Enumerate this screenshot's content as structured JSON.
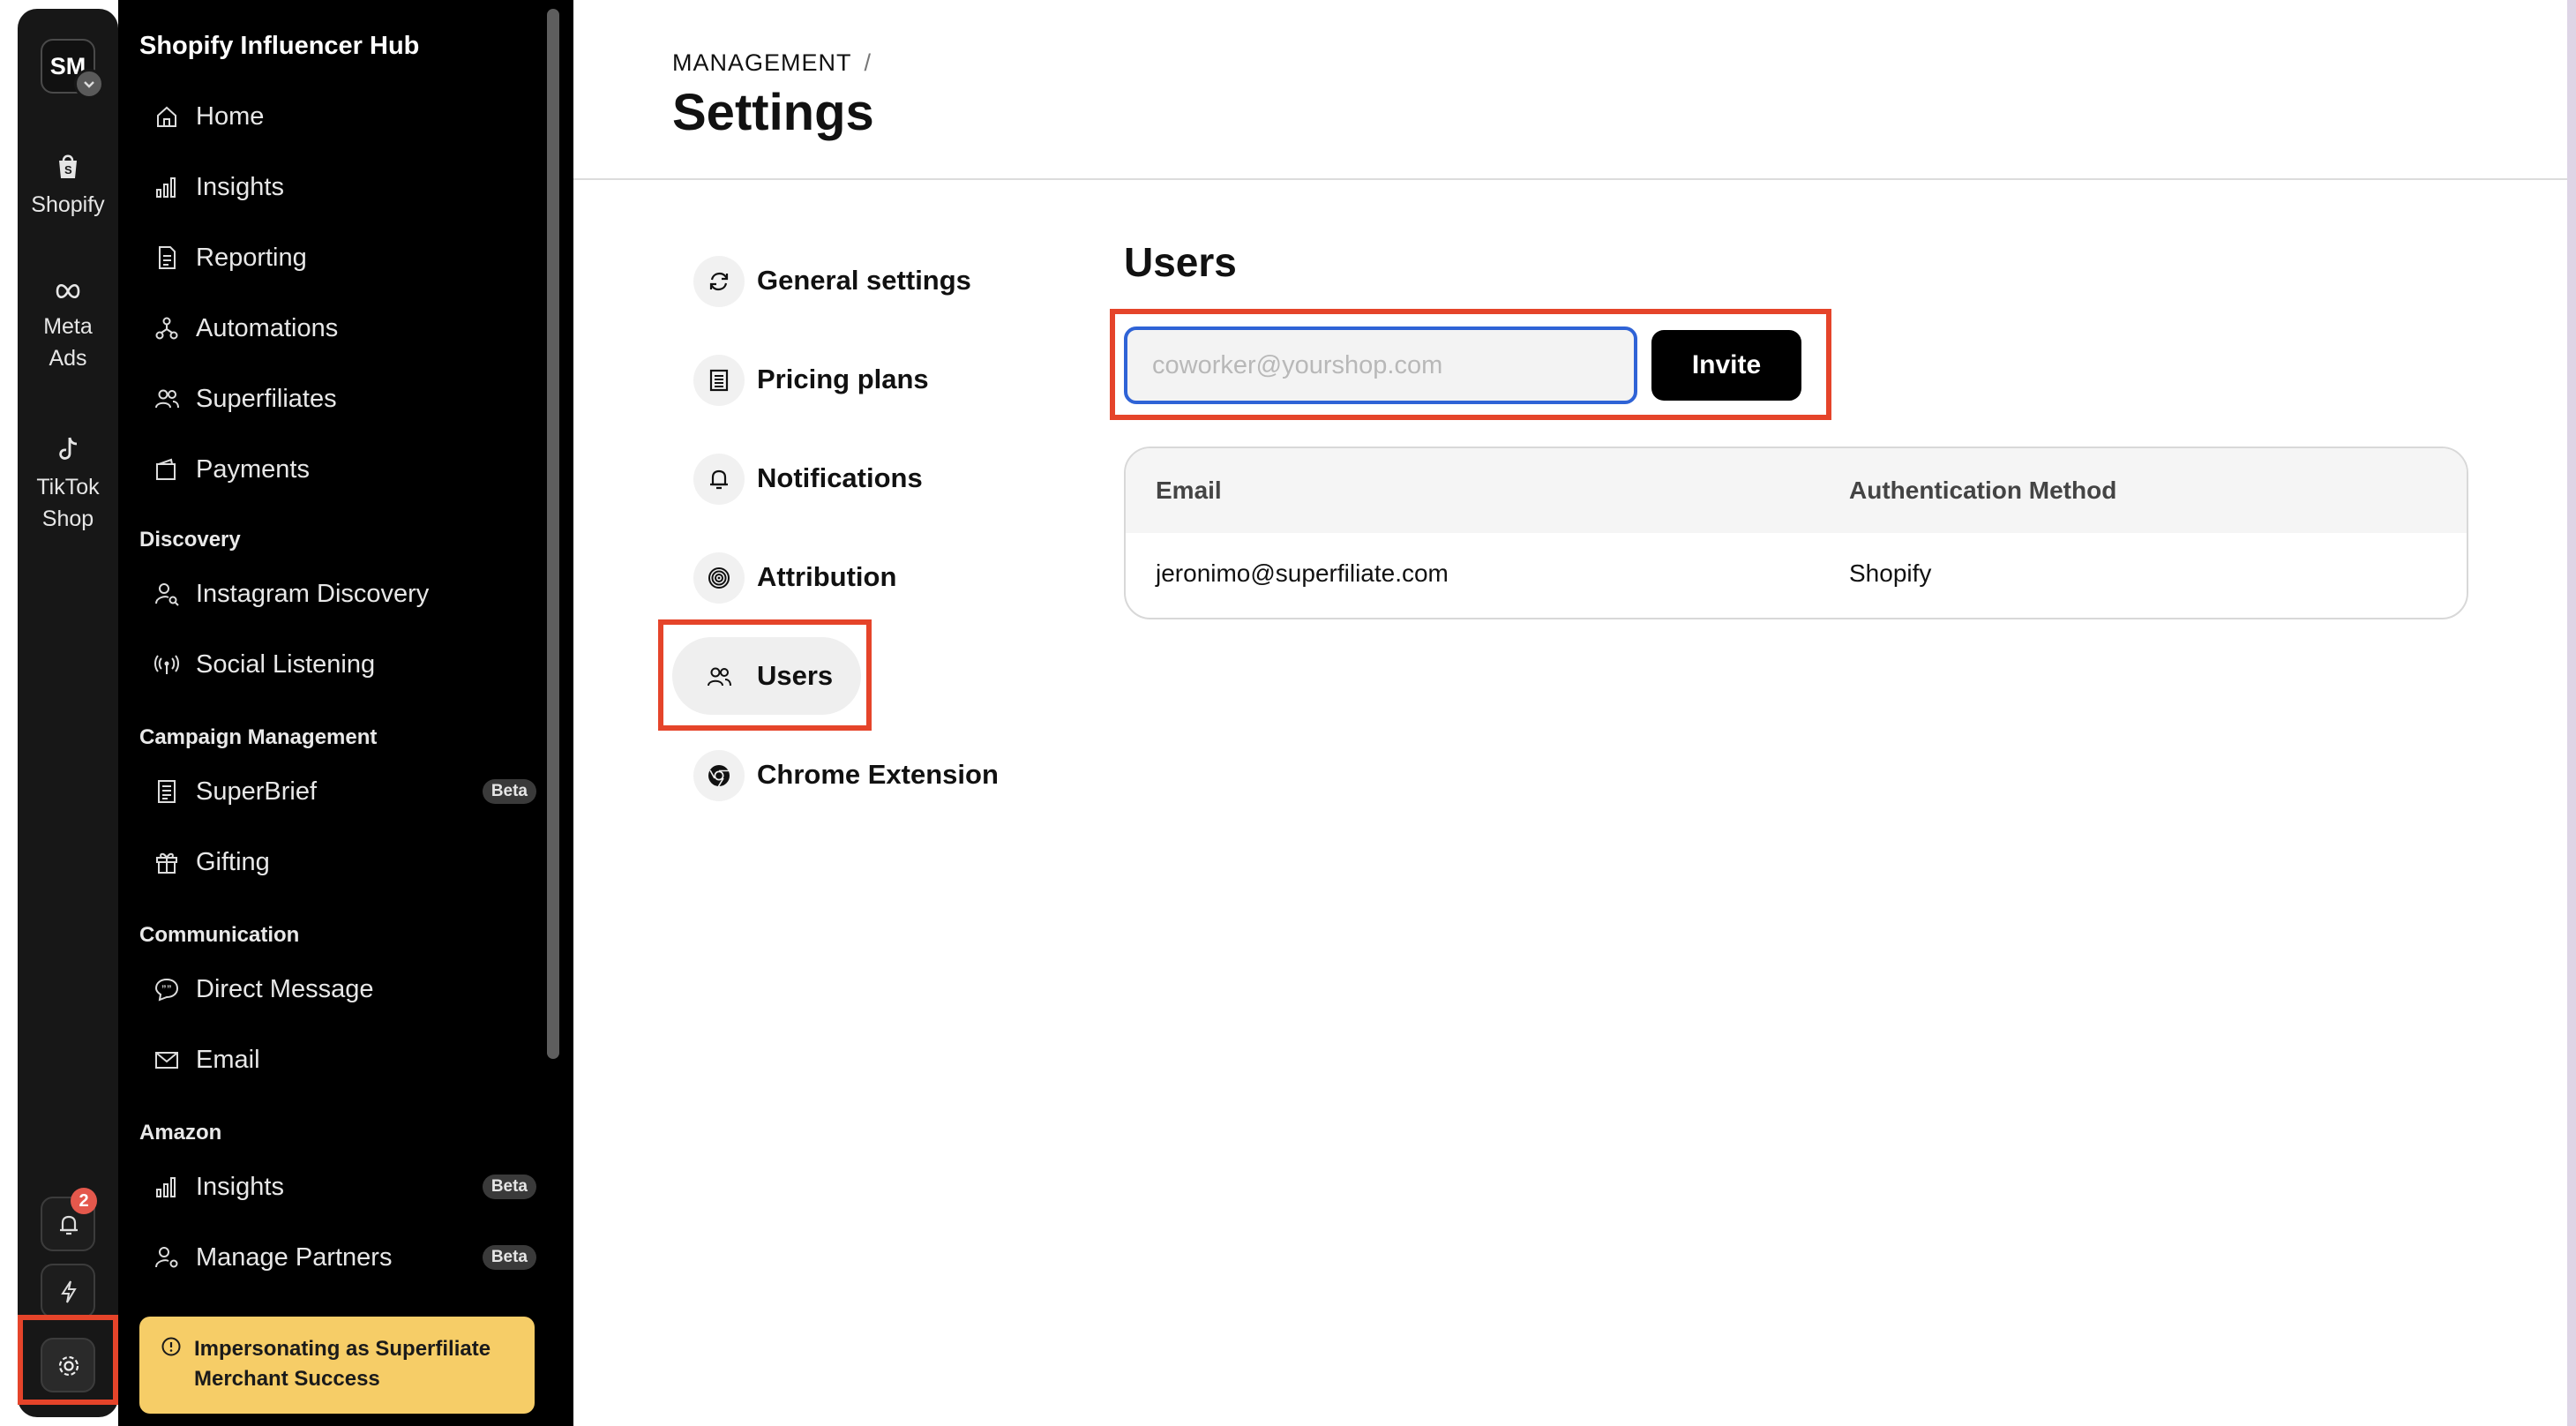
{
  "rail": {
    "avatar_initials": "SM",
    "items": [
      {
        "label": "Shopify",
        "icon": "shopify-bag-icon"
      },
      {
        "label": "Meta Ads",
        "icon": "meta-infinity-icon"
      },
      {
        "label": "TikTok Shop",
        "icon": "tiktok-icon"
      }
    ],
    "notification_count": "2"
  },
  "sidebar": {
    "brand": "Shopify Influencer Hub",
    "main_items": [
      {
        "label": "Home",
        "icon": "home-icon"
      },
      {
        "label": "Insights",
        "icon": "bar-chart-icon"
      },
      {
        "label": "Reporting",
        "icon": "document-icon"
      },
      {
        "label": "Automations",
        "icon": "flow-icon"
      },
      {
        "label": "Superfiliates",
        "icon": "users-icon"
      },
      {
        "label": "Payments",
        "icon": "wallet-icon"
      }
    ],
    "sections": {
      "discovery": "Discovery",
      "campaign": "Campaign Management",
      "communication": "Communication",
      "amazon": "Amazon"
    },
    "discovery_items": [
      {
        "label": "Instagram Discovery"
      },
      {
        "label": "Social Listening"
      }
    ],
    "campaign_items": [
      {
        "label": "SuperBrief",
        "badge": "Beta"
      },
      {
        "label": "Gifting"
      }
    ],
    "communication_items": [
      {
        "label": "Direct Message"
      },
      {
        "label": "Email"
      }
    ],
    "amazon_items": [
      {
        "label": "Insights",
        "badge": "Beta"
      },
      {
        "label": "Manage Partners",
        "badge": "Beta"
      }
    ],
    "impersonation_notice": "Impersonating as Superfiliate Merchant Success"
  },
  "header": {
    "breadcrumb": "MANAGEMENT",
    "breadcrumb_sep": "/",
    "title": "Settings"
  },
  "settings_menu": [
    {
      "label": "General settings",
      "icon": "refresh-icon"
    },
    {
      "label": "Pricing plans",
      "icon": "receipt-icon"
    },
    {
      "label": "Notifications",
      "icon": "bell-icon"
    },
    {
      "label": "Attribution",
      "icon": "target-icon"
    },
    {
      "label": "Users",
      "icon": "users-icon"
    },
    {
      "label": "Chrome Extension",
      "icon": "chrome-icon"
    }
  ],
  "users": {
    "title": "Users",
    "invite_placeholder": "coworker@yourshop.com",
    "invite_value": "",
    "invite_label": "Invite",
    "columns": [
      "Email",
      "Authentication Method"
    ],
    "rows": [
      {
        "email": "jeronimo@superfiliate.com",
        "auth": "Shopify"
      }
    ]
  },
  "colors": {
    "highlight": "#e5442a",
    "notice": "#f6cd67",
    "focus": "#2f63d6"
  }
}
